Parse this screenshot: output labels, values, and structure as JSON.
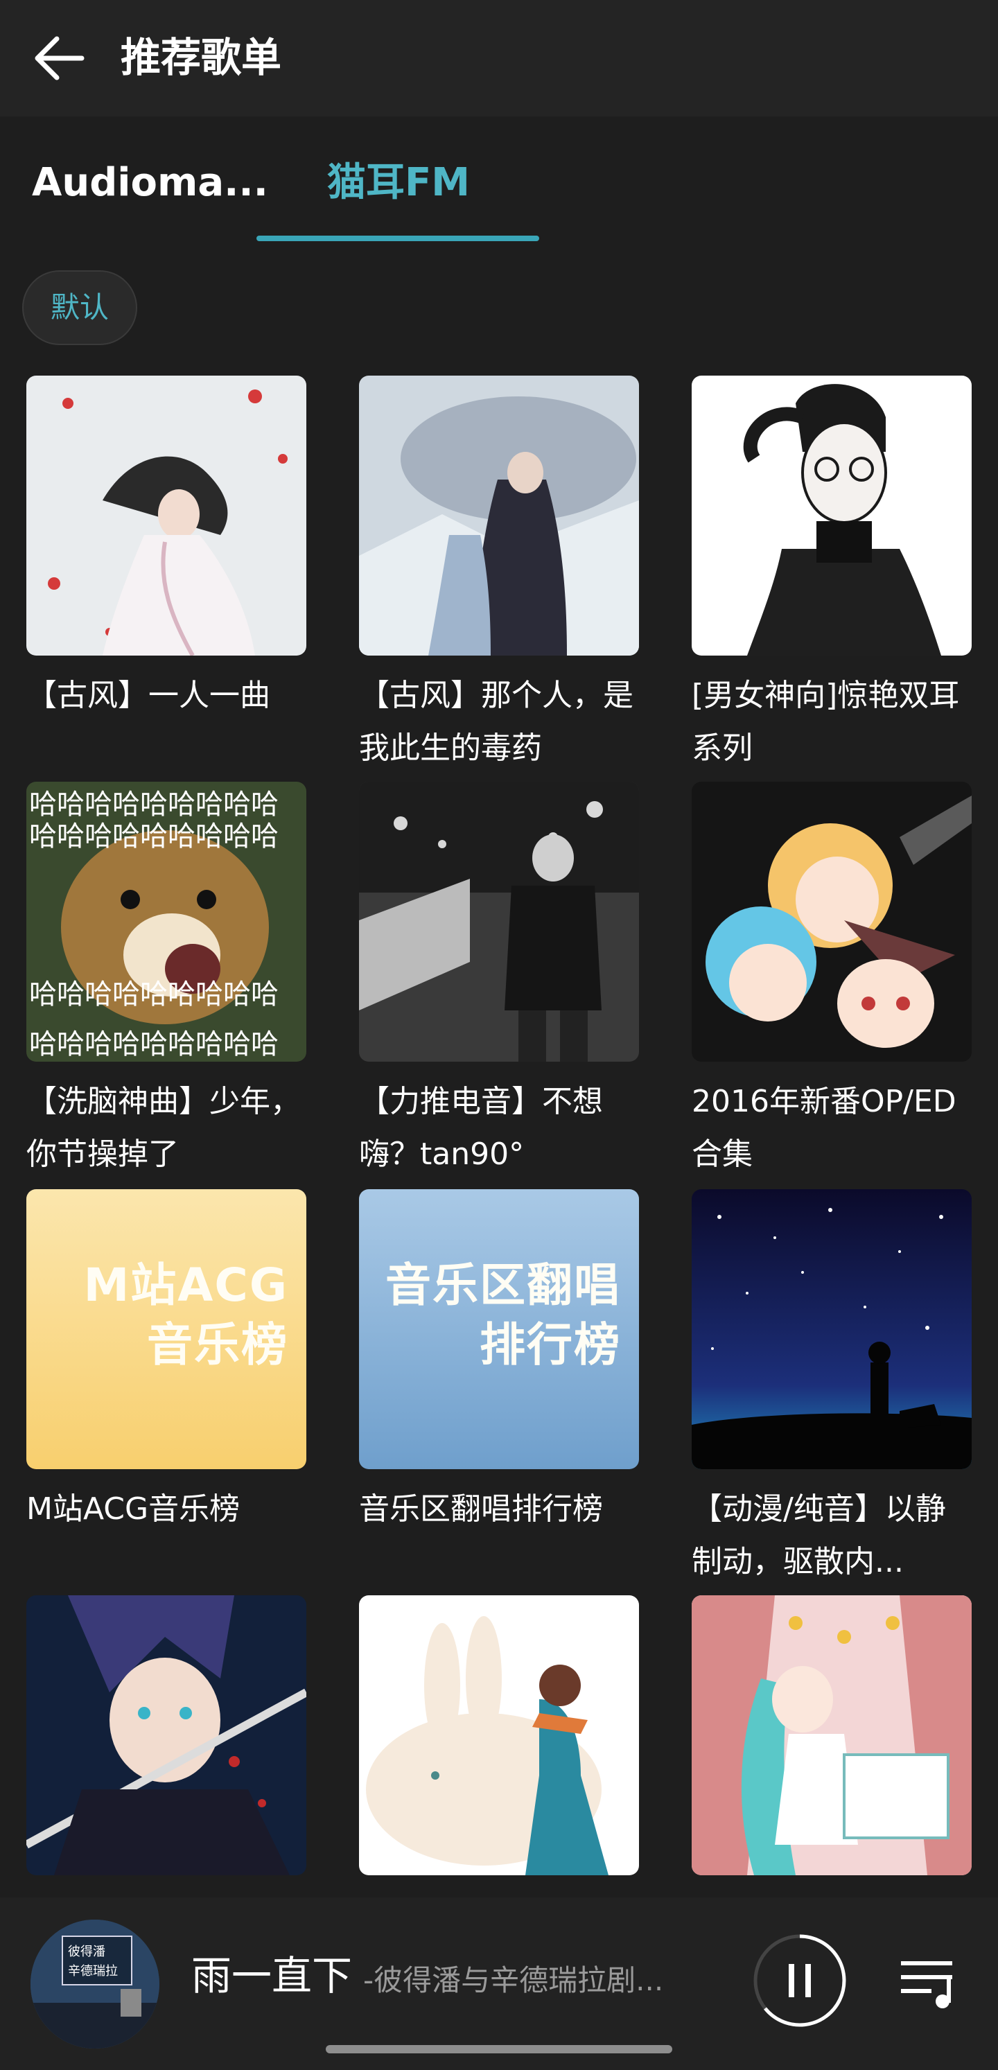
{
  "header": {
    "title": "推荐歌单",
    "back_icon": "arrow-left-icon"
  },
  "tabs": [
    {
      "label": "Audioma...",
      "active": false
    },
    {
      "label": "猫耳FM",
      "active": true
    }
  ],
  "filter": {
    "label": "默认"
  },
  "playlists": [
    {
      "title": "【古风】一人一曲"
    },
    {
      "title": "【古风】那个人，是我此生的毒药"
    },
    {
      "title": "[男女神向]惊艳双耳系列"
    },
    {
      "title": "【洗脑神曲】少年，你节操掉了"
    },
    {
      "title": "【力推电音】不想嗨？tan90°"
    },
    {
      "title": "2016年新番OP/ED合集"
    },
    {
      "title": "M站ACG音乐榜",
      "cover_text": [
        "M站ACG",
        "音乐榜"
      ]
    },
    {
      "title": "音乐区翻唱排行榜",
      "cover_text": [
        "音乐区翻唱",
        "排行榜"
      ]
    },
    {
      "title": "【动漫/纯音】以静制动，驱散内..."
    },
    {
      "title": ""
    },
    {
      "title": ""
    },
    {
      "title": ""
    }
  ],
  "meme_text": "哈哈哈哈哈哈哈哈哈",
  "player": {
    "song": "雨一直下",
    "artist": "-彼得潘与辛德瑞拉剧...",
    "art_text": [
      "彼得潘",
      "辛德瑞拉"
    ],
    "play_state": "playing"
  },
  "colors": {
    "accent": "#3aa6b8",
    "background": "#1e1e1e",
    "header": "#242424"
  }
}
